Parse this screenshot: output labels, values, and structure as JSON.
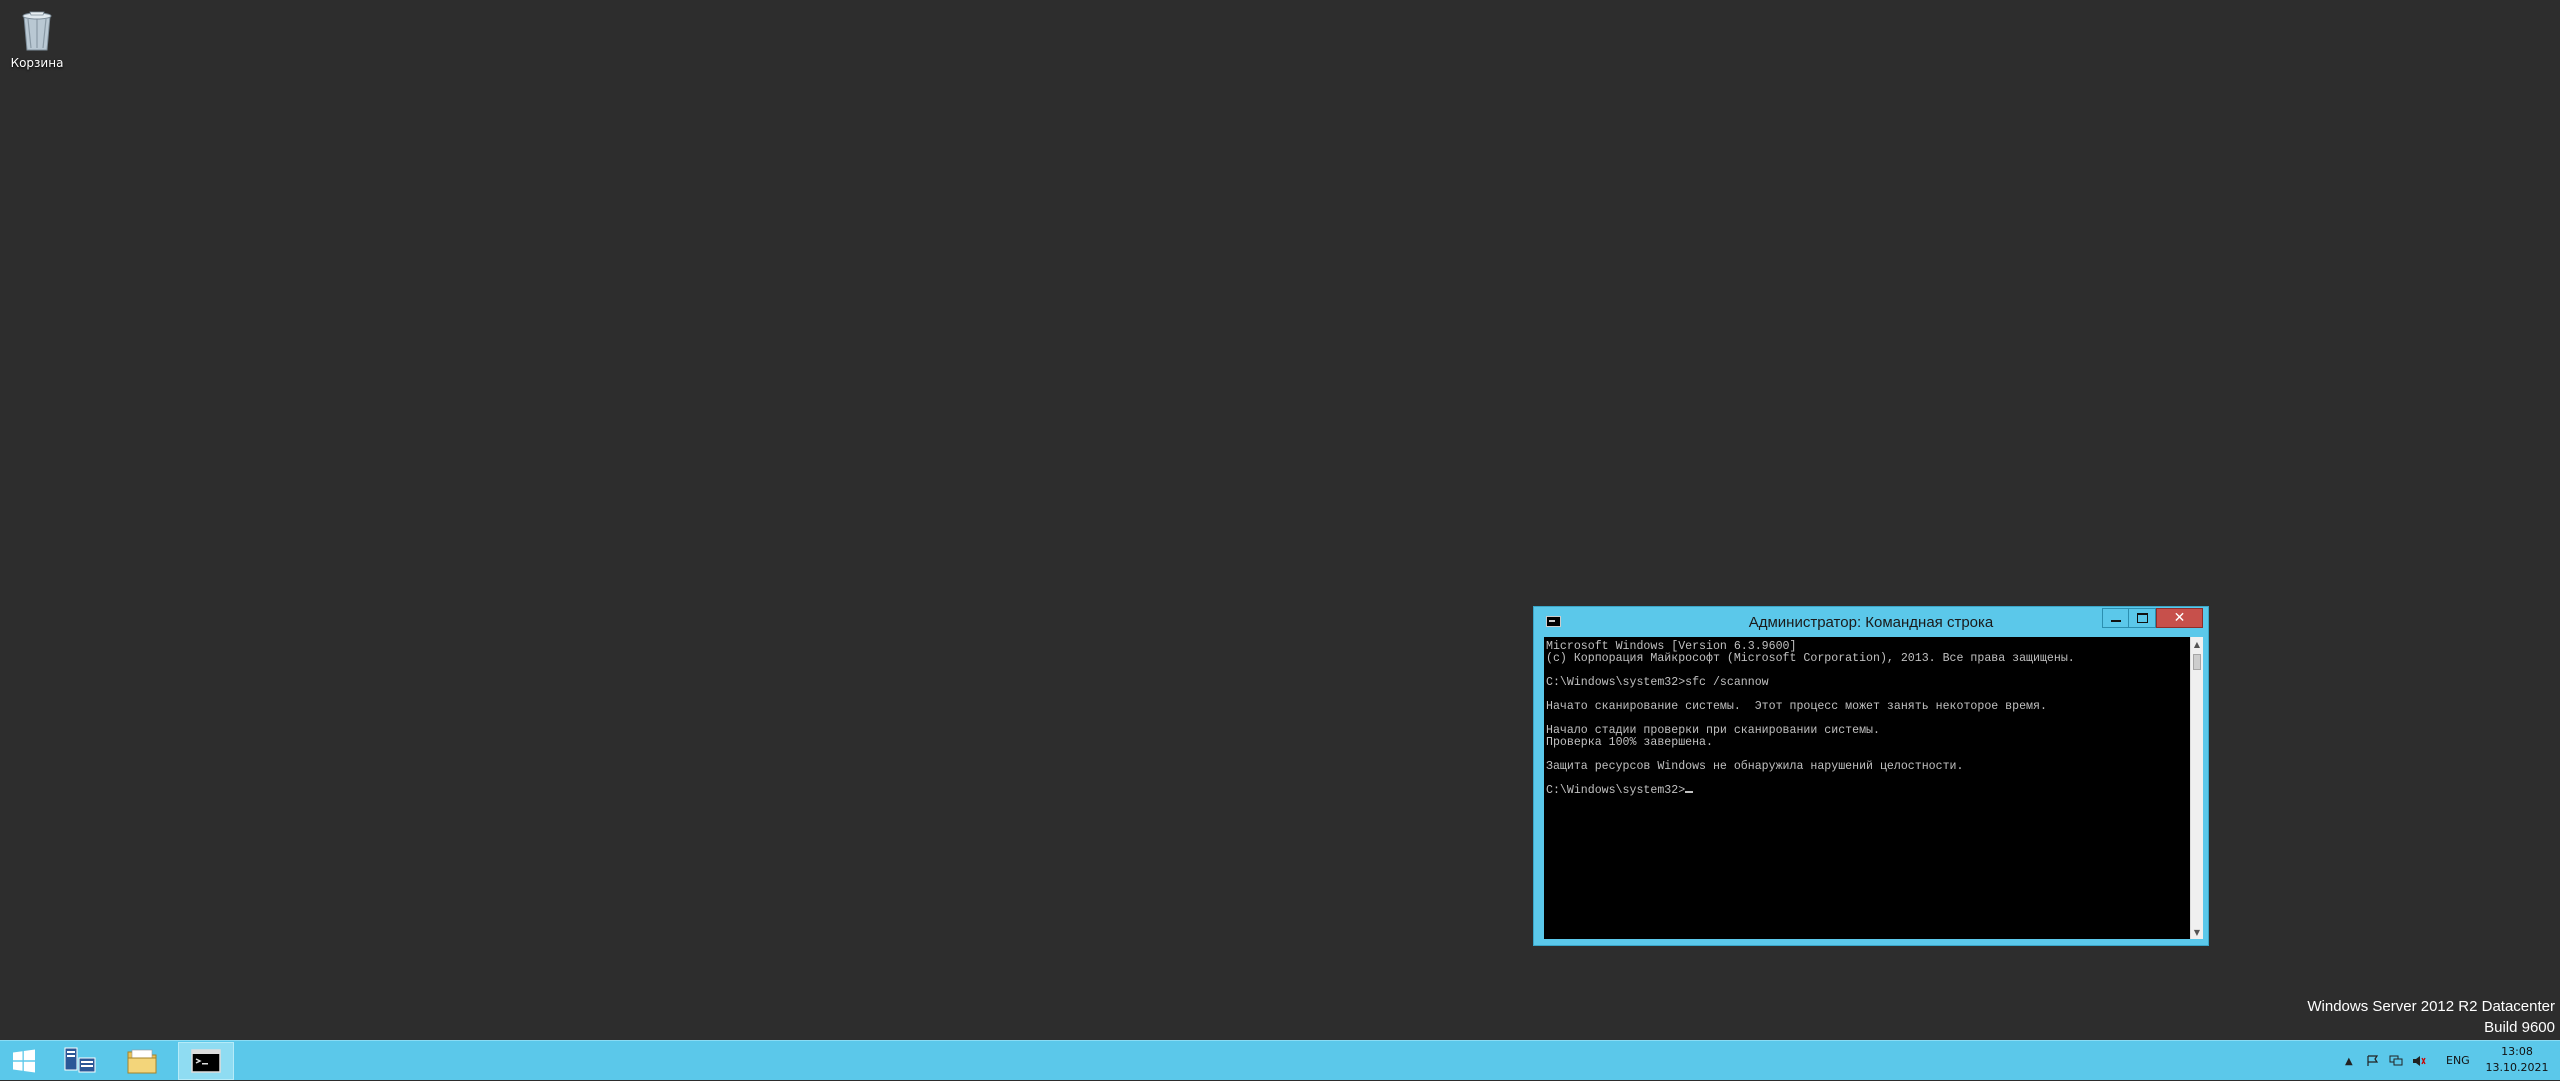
{
  "desktop": {
    "recycle_bin_label": "Корзина",
    "watermark_line1": "Windows Server 2012 R2 Datacenter",
    "watermark_line2": "Build 9600"
  },
  "window": {
    "title": "Администратор: Командная строка",
    "minimize_glyph": "",
    "maximize_glyph": "",
    "close_glyph": "✕",
    "console_lines": [
      "Microsoft Windows [Version 6.3.9600]",
      "(c) Корпорация Майкрософт (Microsoft Corporation), 2013. Все права защищены.",
      "",
      "C:\\Windows\\system32>sfc /scannow",
      "",
      "Начато сканирование системы.  Этот процесс может занять некоторое время.",
      "",
      "Начало стадии проверки при сканировании системы.",
      "Проверка 100% завершена.",
      "",
      "Защита ресурсов Windows не обнаружила нарушений целостности.",
      ""
    ],
    "prompt": "C:\\Windows\\system32>",
    "scroll_up_glyph": "▲",
    "scroll_down_glyph": "▼"
  },
  "taskbar": {
    "tray_up_glyph": "▲",
    "language": "ENG",
    "time": "13:08",
    "date": "13.10.2021"
  },
  "colors": {
    "accent": "#5bc8ea",
    "desktop": "#2d2d2d",
    "close": "#c7504b"
  }
}
